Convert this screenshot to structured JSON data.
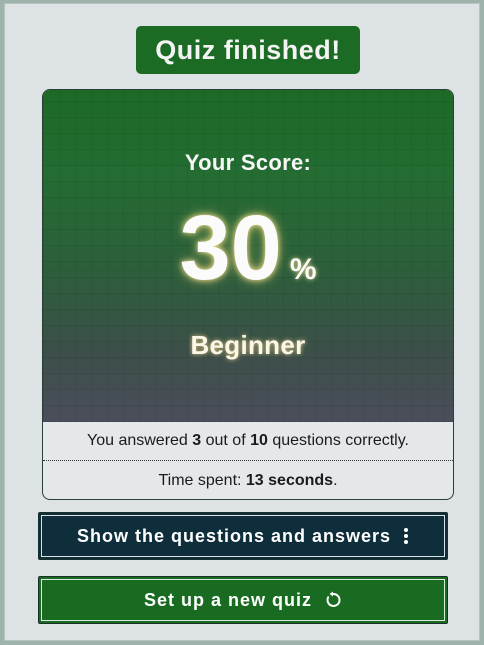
{
  "header": {
    "title": "Quiz finished!"
  },
  "score": {
    "label": "Your Score:",
    "value": "30",
    "unit": "%",
    "level": "Beginner"
  },
  "summary": {
    "correct_prefix": "You answered ",
    "correct_count": "3",
    "correct_middle": " out of ",
    "total_count": "10",
    "correct_suffix": " questions correctly.",
    "time_prefix": "Time spent: ",
    "time_value": "13 seconds",
    "time_suffix": "."
  },
  "actions": {
    "show_answers_label": "Show the questions and answers",
    "show_answers_icon": "vertical-ellipsis-icon",
    "new_quiz_label": "Set up a new quiz",
    "new_quiz_icon": "restart-icon"
  },
  "colors": {
    "brand_green": "#1b6b25",
    "dark_teal": "#0f2e3b",
    "panel_bg": "#dde2e4"
  }
}
